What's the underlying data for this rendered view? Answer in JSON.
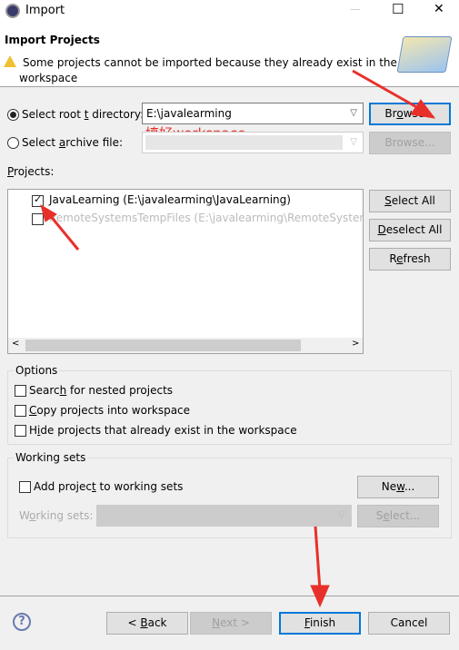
{
  "window": {
    "title": "Import",
    "minimize": "—",
    "maximize": "☐",
    "close": "✕"
  },
  "header": {
    "title": "Import Projects",
    "message": "Some projects cannot be imported because they already exist in the",
    "message2": "workspace"
  },
  "source": {
    "root_label_a": "Select root ",
    "root_label_u": "t",
    "root_label_b": " directory:",
    "root_selected": true,
    "root_value": "E:\\javalearming",
    "browse_a": "Br",
    "browse_u": "o",
    "browse_b": "wse...",
    "archive_label_a": "Select ",
    "archive_label_u": "a",
    "archive_label_b": "rchive file:",
    "archive_value": "",
    "browse2": "Browse..."
  },
  "annotation": {
    "text": "填好workspace",
    "color": "#e8302a"
  },
  "projects": {
    "label_u": "P",
    "label_b": "rojects:",
    "items": [
      {
        "label": "JavaLearning (E:\\javalearming\\JavaLearning)",
        "checked": true,
        "enabled": true
      },
      {
        "label": "RemoteSystemsTempFiles (E:\\javalearming\\RemoteSystems",
        "checked": false,
        "enabled": false
      }
    ],
    "select_all_u": "S",
    "select_all_b": "elect All",
    "deselect_all_u": "D",
    "deselect_all_b": "eselect All",
    "refresh_a": "R",
    "refresh_u": "e",
    "refresh_b": "fresh"
  },
  "options": {
    "title": "Options",
    "items": [
      {
        "a": "Searc",
        "u": "h",
        "b": " for nested projects",
        "checked": false
      },
      {
        "a": "",
        "u": "C",
        "b": "opy projects into workspace",
        "checked": false
      },
      {
        "a": "H",
        "u": "i",
        "b": "de projects that already exist in the workspace",
        "checked": false
      }
    ]
  },
  "working_sets": {
    "title": "Working sets",
    "add_a": "Add projec",
    "add_u": "t",
    "add_b": " to working sets",
    "add_checked": false,
    "new_a": "Ne",
    "new_u": "w",
    "new_b": "...",
    "sets_a": "W",
    "sets_u": "o",
    "sets_b": "rking sets:",
    "select_a": "S",
    "select_u": "e",
    "select_b": "lect..."
  },
  "footer": {
    "help": "?",
    "back_a": "< ",
    "back_u": "B",
    "back_b": "ack",
    "next_u": "N",
    "next_b": "ext >",
    "finish_u": "F",
    "finish_b": "inish",
    "cancel": "Cancel"
  }
}
